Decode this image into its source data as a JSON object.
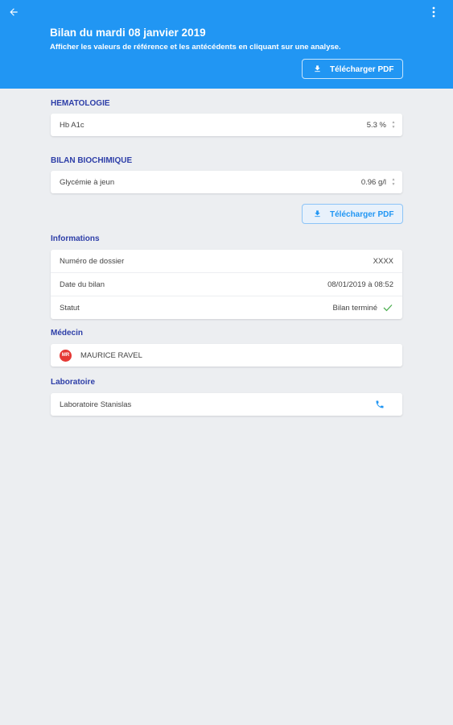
{
  "header": {
    "title": "Bilan du mardi 08 janvier 2019",
    "subtitle": "Afficher les valeurs de référence et les antécédents en cliquant sur une analyse.",
    "pdf_label": "Télécharger PDF",
    "back_icon": "arrow-left-icon",
    "menu_icon": "more-vertical-icon"
  },
  "sections": {
    "hematologie": {
      "title": "HEMATOLOGIE",
      "row": {
        "label": "Hb A1c",
        "value": "5.3 %"
      }
    },
    "biochimique": {
      "title": "BILAN BIOCHIMIQUE",
      "row": {
        "label": "Glycémie à jeun",
        "value": "0.96 g/l"
      }
    }
  },
  "pdf_button": {
    "label": "Télécharger PDF"
  },
  "informations": {
    "title": "Informations",
    "rows": [
      {
        "label": "Numéro de dossier",
        "value": "XXXX"
      },
      {
        "label": "Date du bilan",
        "value": "08/01/2019 à 08:52"
      },
      {
        "label": "Statut",
        "value": "Bilan terminé"
      }
    ]
  },
  "medecin": {
    "title": "Médecin",
    "initials": "MR",
    "name": "MAURICE RAVEL"
  },
  "laboratoire": {
    "title": "Laboratoire",
    "name": "Laboratoire Stanislas"
  },
  "colors": {
    "primary": "#2196f3",
    "section_title": "#2d3ea8",
    "avatar": "#e53935",
    "check": "#4caf50",
    "background": "#eceef1"
  }
}
